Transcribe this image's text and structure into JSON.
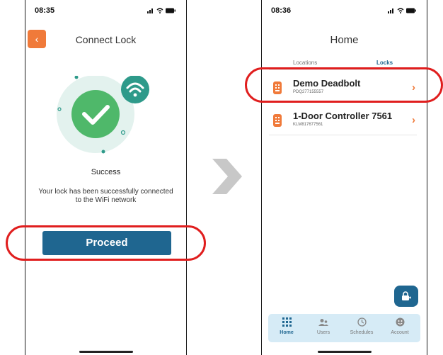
{
  "screen1": {
    "time": "08:35",
    "title": "Connect Lock",
    "back_icon": "chevron-left-icon",
    "status_text": "Success",
    "description": "Your lock has been successfully connected to the WiFi network",
    "proceed_label": "Proceed"
  },
  "screen2": {
    "time": "08:36",
    "title": "Home",
    "tabs": [
      {
        "label": "Locations",
        "active": false
      },
      {
        "label": "Locks",
        "active": true
      }
    ],
    "locks": [
      {
        "name": "Demo Deadbolt",
        "serial": "PDQ277155557"
      },
      {
        "name": "1-Door Controller 7561",
        "serial": "KLM817677561"
      }
    ],
    "nav": [
      {
        "label": "Home",
        "icon": "grid-icon",
        "active": true
      },
      {
        "label": "Users",
        "icon": "users-icon",
        "active": false
      },
      {
        "label": "Schedules",
        "icon": "clock-icon",
        "active": false
      },
      {
        "label": "Account",
        "icon": "account-icon",
        "active": false
      }
    ]
  },
  "colors": {
    "accent_orange": "#f07a3a",
    "primary_blue": "#1f6690",
    "success_green": "#4fb86a",
    "wifi_teal": "#2e9a8a",
    "highlight_red": "#e01e1e"
  }
}
